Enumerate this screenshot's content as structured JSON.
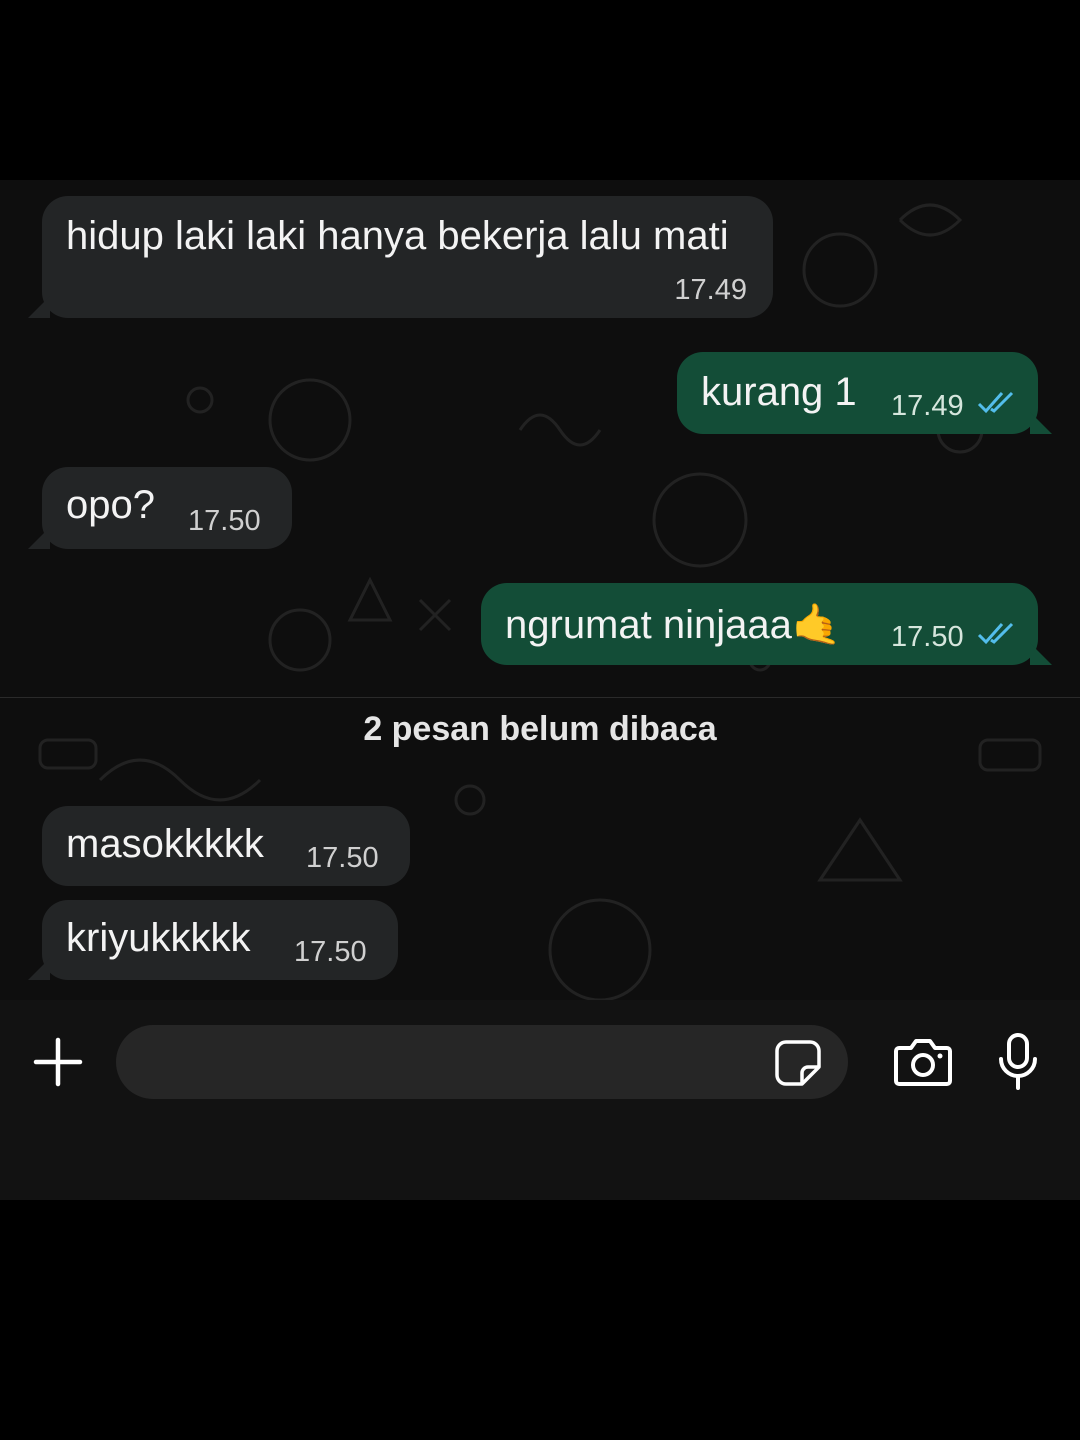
{
  "messages": [
    {
      "direction": "in",
      "text": "hidup laki laki hanya bekerja lalu mati",
      "time": "17.49"
    },
    {
      "direction": "out",
      "text": "kurang 1",
      "time": "17.49",
      "status": "read"
    },
    {
      "direction": "in",
      "text": "opo?",
      "time": "17.50"
    },
    {
      "direction": "out",
      "text": "ngrumat ninjaaa🤙",
      "time": "17.50",
      "status": "read"
    },
    {
      "direction": "in",
      "text": "masokkkkk",
      "time": "17.50"
    },
    {
      "direction": "in",
      "text": "kriyukkkkk",
      "time": "17.50"
    }
  ],
  "unread_separator": "2 pesan belum dibaca",
  "input_bar": {
    "field_value": "",
    "icons": [
      "plus-icon",
      "sticker-icon",
      "camera-icon",
      "microphone-icon"
    ]
  },
  "colors": {
    "incoming_bubble": "#232526",
    "outgoing_bubble": "#134d37",
    "read_ticks": "#53bdeb",
    "chat_background": "#0e0e0e"
  }
}
